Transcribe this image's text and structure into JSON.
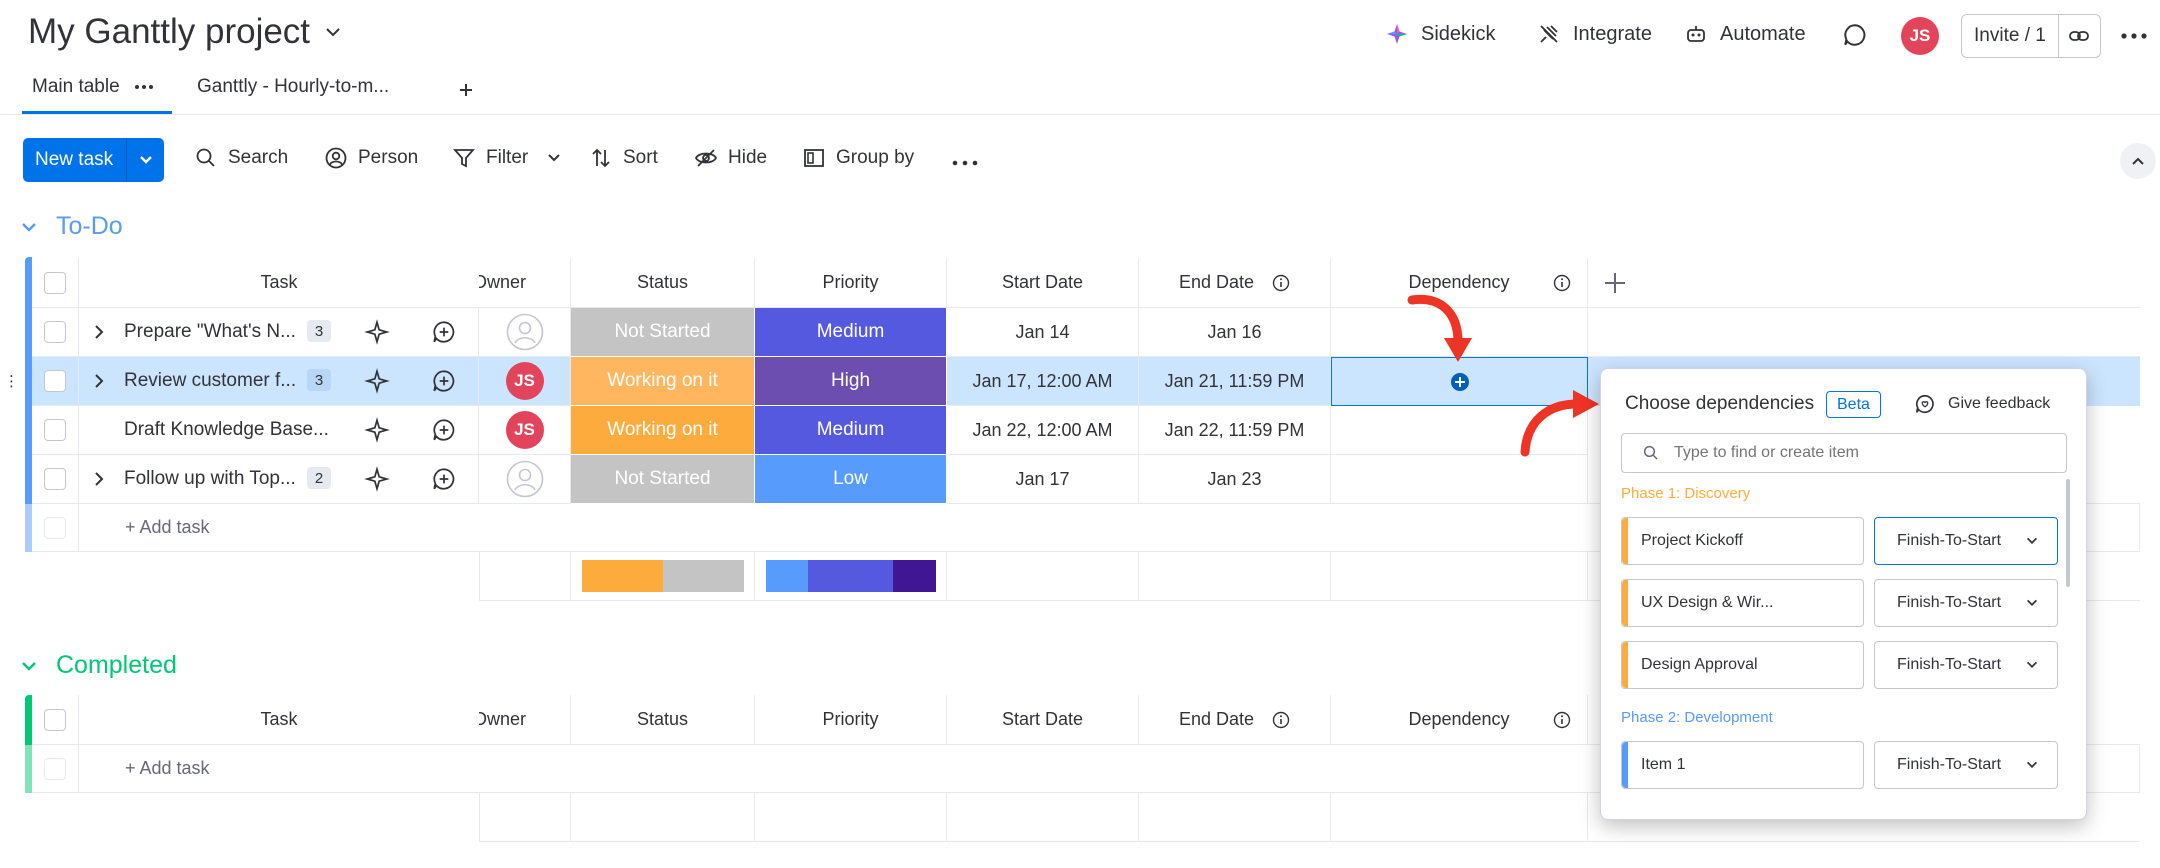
{
  "header": {
    "project_title": "My Ganttly project",
    "sidekick_label": "Sidekick",
    "integrate_label": "Integrate",
    "automate_label": "Automate",
    "user_initials": "JS",
    "invite_label": "Invite / 1"
  },
  "tabs": [
    {
      "label": "Main table"
    },
    {
      "label": "Ganttly - Hourly-to-m..."
    }
  ],
  "toolbar": {
    "new_task_label": "New task",
    "search_label": "Search",
    "person_label": "Person",
    "filter_label": "Filter",
    "sort_label": "Sort",
    "hide_label": "Hide",
    "group_by_label": "Group by"
  },
  "columns": {
    "task": "Task",
    "owner": "Owner",
    "status": "Status",
    "priority": "Priority",
    "start_date": "Start Date",
    "end_date": "End Date",
    "dependency": "Dependency"
  },
  "groups": {
    "todo": {
      "title": "To-Do",
      "color": "#579bfc",
      "add_task_label": "+ Add task",
      "rows": [
        {
          "task": "Prepare \"What's N...",
          "subitems": "3",
          "owner": "",
          "status": "Not Started",
          "status_color": "#c4c4c4",
          "priority": "Medium",
          "priority_color": "#5559df",
          "start": "Jan 14",
          "end": "Jan 16"
        },
        {
          "task": "Review customer f...",
          "subitems": "3",
          "owner": "JS",
          "status": "Working on it",
          "status_color": "#ffb65f",
          "priority": "High",
          "priority_color": "#6c4db0",
          "start": "Jan 17, 12:00 AM",
          "end": "Jan 21, 11:59 PM"
        },
        {
          "task": "Draft Knowledge Base...",
          "subitems": "",
          "owner": "JS",
          "status": "Working on it",
          "status_color": "#fdab3d",
          "priority": "Medium",
          "priority_color": "#5559df",
          "start": "Jan 22, 12:00 AM",
          "end": "Jan 22, 11:59 PM"
        },
        {
          "task": "Follow up with Top...",
          "subitems": "2",
          "owner": "",
          "status": "Not Started",
          "status_color": "#c4c4c4",
          "priority": "Low",
          "priority_color": "#579bfc",
          "start": "Jan 17",
          "end": "Jan 23"
        }
      ],
      "status_summary": [
        {
          "color": "#fdab3d",
          "fraction": 0.5
        },
        {
          "color": "#c4c4c4",
          "fraction": 0.5
        }
      ],
      "priority_summary": [
        {
          "color": "#579bfc",
          "fraction": 0.25
        },
        {
          "color": "#5559df",
          "fraction": 0.5
        },
        {
          "color": "#401694",
          "fraction": 0.25
        }
      ]
    },
    "completed": {
      "title": "Completed",
      "color": "#00c875",
      "add_task_label": "+ Add task"
    }
  },
  "dependency_popup": {
    "title": "Choose dependencies",
    "beta_label": "Beta",
    "feedback_label": "Give feedback",
    "search_placeholder": "Type to find or create item",
    "phases": [
      {
        "label": "Phase 1: Discovery",
        "color": "#fdab3d",
        "items": [
          {
            "name": "Project Kickoff",
            "type": "Finish-To-Start",
            "active": true
          },
          {
            "name": "UX Design & Wir...",
            "type": "Finish-To-Start",
            "active": false
          },
          {
            "name": "Design Approval",
            "type": "Finish-To-Start",
            "active": false
          }
        ]
      },
      {
        "label": "Phase 2: Development",
        "color": "#579bfc",
        "items": [
          {
            "name": "Item 1",
            "type": "Finish-To-Start",
            "active": false
          }
        ]
      }
    ]
  },
  "colors": {
    "accent": "#0073ea",
    "annotation_arrow": "#ee3424"
  }
}
